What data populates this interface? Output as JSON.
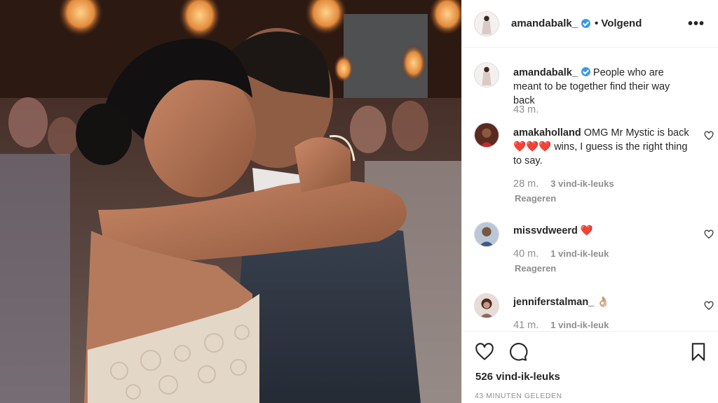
{
  "post": {
    "author": "amandabalk_",
    "follow_separator": "•",
    "follow_label": "Volgend",
    "more_label": "•••",
    "like_count": "526 vind-ik-leuks",
    "timestamp": "43 MINUTEN GELEDEN",
    "photo_icon": "wedding-dance-photo"
  },
  "caption": {
    "username": "amandabalk_",
    "text": "People who are meant to be together find their way back",
    "time": "43 m."
  },
  "comments": [
    {
      "username": "amakaholland",
      "text": "OMG Mr Mystic is back ❤️❤️❤️ wins, I guess is the right thing to say.",
      "time": "28 m.",
      "likes": "3 vind-ik-leuks",
      "reply": "Reageren"
    },
    {
      "username": "missvdweerd",
      "text": "❤️",
      "time": "40 m.",
      "likes": "1 vind-ik-leuk",
      "reply": "Reageren"
    },
    {
      "username": "jenniferstalman_",
      "text": "👌🏼",
      "time": "41 m.",
      "likes": "1 vind-ik-leuk"
    }
  ],
  "colors": {
    "accent": "#3897f0",
    "heart": "#ed4956",
    "muted": "#8e8e8e",
    "text": "#262626"
  }
}
